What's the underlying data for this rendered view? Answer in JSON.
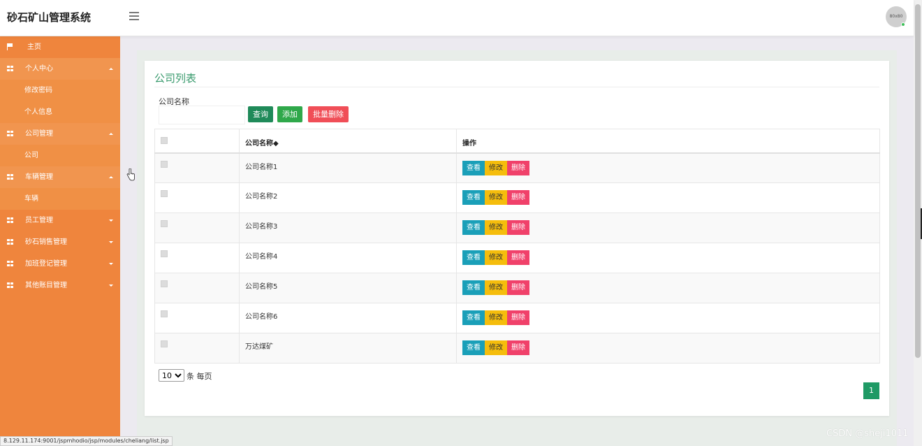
{
  "header": {
    "brand": "砂石矿山管理系统",
    "avatar_text": "80x80"
  },
  "sidebar": {
    "home": "主页",
    "groups": [
      {
        "label": "个人中心",
        "children": [
          "修改密码",
          "个人信息"
        ]
      },
      {
        "label": "公司管理",
        "children": [
          "公司"
        ]
      },
      {
        "label": "车辆管理",
        "children": [
          "车辆"
        ]
      },
      {
        "label": "员工管理",
        "children": []
      },
      {
        "label": "砂石销售管理",
        "children": []
      },
      {
        "label": "加班登记管理",
        "children": []
      },
      {
        "label": "其他账目管理",
        "children": []
      }
    ]
  },
  "main": {
    "title": "公司列表",
    "search": {
      "label": "公司名称",
      "value": "",
      "placeholder": ""
    },
    "buttons": {
      "query": "查询",
      "add": "添加",
      "batch_delete": "批量删除"
    },
    "table": {
      "columns": [
        "",
        "公司名称◆",
        "操作"
      ],
      "rows": [
        {
          "name": "公司名称1"
        },
        {
          "name": "公司名称2"
        },
        {
          "name": "公司名称3"
        },
        {
          "name": "公司名称4"
        },
        {
          "name": "公司名称5"
        },
        {
          "name": "公司名称6"
        },
        {
          "name": "万达煤矿"
        }
      ],
      "actions": {
        "view": "查看",
        "edit": "修改",
        "delete": "删除"
      }
    },
    "pagination": {
      "page_size": "10",
      "page_size_suffix": "条 每页",
      "current_page": "1"
    }
  },
  "statusbar": {
    "url": "8.129.11.174:9001/jspmhodio/jsp/modules/cheliang/list.jsp"
  },
  "watermark": "CSDN @sheji1011",
  "colors": {
    "sidebar": "#ef853d",
    "title": "#3a9b6e",
    "query": "#1f8a59",
    "add": "#2fa84a",
    "batch_delete": "#f04e57",
    "view": "#1a9fb8",
    "edit": "#f5bd0c",
    "delete": "#f0416a"
  }
}
